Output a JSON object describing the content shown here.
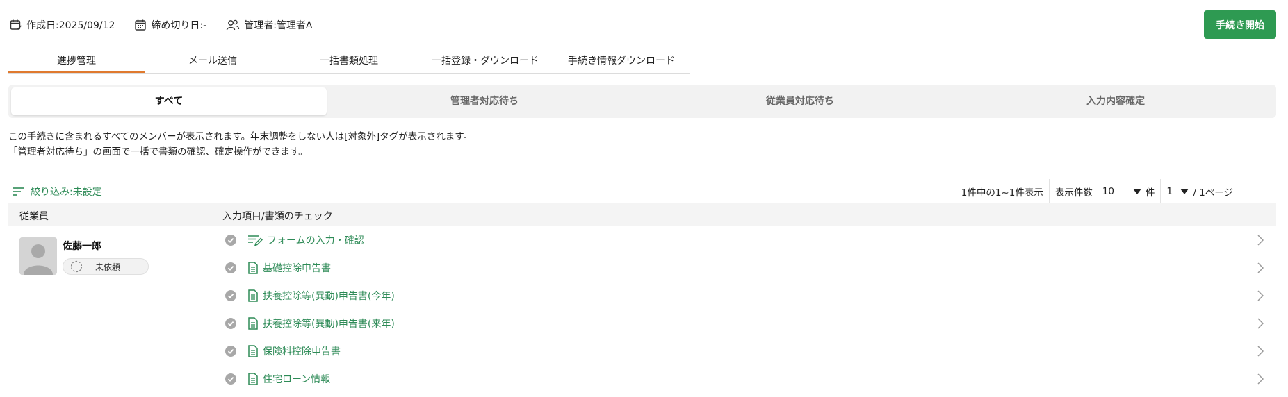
{
  "meta": {
    "created": "作成日:2025/09/12",
    "deadline": "締め切り日:-",
    "manager": "管理者:管理者A"
  },
  "start_button": "手続き開始",
  "main_tabs": [
    {
      "label": "進捗管理",
      "active": true
    },
    {
      "label": "メール送信"
    },
    {
      "label": "一括書類処理"
    },
    {
      "label": "一括登録・ダウンロード"
    },
    {
      "label": "手続き情報ダウンロード"
    }
  ],
  "filter_tabs": [
    {
      "label": "すべて",
      "active": true
    },
    {
      "label": "管理者対応待ち"
    },
    {
      "label": "従業員対応待ち"
    },
    {
      "label": "入力内容確定"
    }
  ],
  "description": {
    "line1": "この手続きに含まれるすべてのメンバーが表示されます。年末調整をしない人は[対象外]タグが表示されます。",
    "line2": "「管理者対応待ち」の画面で一括で書類の確認、確定操作ができます。"
  },
  "filter": {
    "label": "絞り込み:未設定"
  },
  "pager": {
    "summary": "1件中の1~1件表示",
    "per_page_label": "表示件数",
    "per_page_value": "10",
    "per_page_unit": "件",
    "page_value": "1",
    "page_total": "/ 1ページ"
  },
  "table": {
    "col_employee": "従業員",
    "col_checks": "入力項目/書類のチェック"
  },
  "employee": {
    "name": "佐藤一郎",
    "status": "未依頼"
  },
  "checks": [
    {
      "label": "フォームの入力・確認",
      "icon": "form-edit-icon"
    },
    {
      "label": "基礎控除申告書",
      "icon": "document-icon"
    },
    {
      "label": "扶養控除等(異動)申告書(今年)",
      "icon": "document-icon"
    },
    {
      "label": "扶養控除等(異動)申告書(来年)",
      "icon": "document-icon"
    },
    {
      "label": "保険料控除申告書",
      "icon": "document-icon"
    },
    {
      "label": "住宅ローン情報",
      "icon": "document-icon"
    }
  ],
  "colors": {
    "accent_green": "#2e9a52",
    "link_green": "#2e8b57",
    "tab_underline": "#e07a2e"
  }
}
